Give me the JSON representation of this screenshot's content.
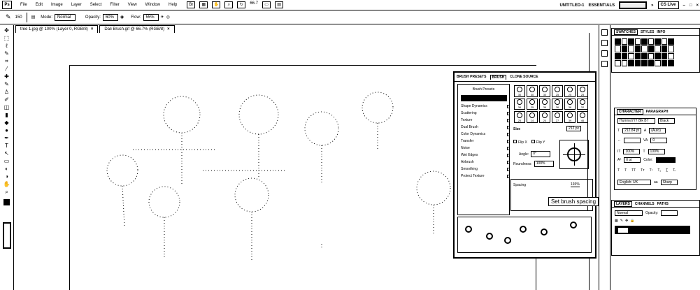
{
  "menubar": {
    "logo": "Ps",
    "items": [
      "File",
      "Edit",
      "Image",
      "Layer",
      "Select",
      "Filter",
      "View",
      "Window",
      "Help"
    ],
    "zoom": "66.7",
    "workspace": "UNTITLED-1",
    "essentials": "ESSENTIALS",
    "cs_live": "CS Live"
  },
  "options": {
    "brush_size": "150",
    "mode_label": "Mode:",
    "mode_value": "Normal",
    "opacity_label": "Opacity:",
    "opacity_value": "60%",
    "flow_label": "Flow:",
    "flow_value": "55%"
  },
  "tabs": [
    {
      "label": "tree 1.jpg @ 100% (Layer 0, RGB/8)"
    },
    {
      "label": "Dali Brush.gif @ 66.7% (RGB/8)"
    }
  ],
  "brush_panel": {
    "tabs": [
      "BRUSH PRESETS",
      "BRUSH",
      "CLONE SOURCE"
    ],
    "presets_button": "Brush Presets",
    "brush_tip_label": "Brush Tip Shape",
    "options": [
      "Shape Dynamics",
      "Scattering",
      "Texture",
      "Dual Brush",
      "Color Dynamics",
      "Transfer",
      "Noise",
      "Wet Edges",
      "Airbrush",
      "Smoothing",
      "Protect Texture"
    ],
    "tip_sizes": [
      "30",
      "30",
      "30",
      "25",
      "25",
      "25",
      "36",
      "25",
      "36",
      "36",
      "36",
      "32",
      "25",
      "14",
      "24",
      "27",
      "39",
      "46"
    ],
    "size_label": "Size",
    "size_value": "212 px",
    "flip_x": "Flip X",
    "flip_y": "Flip Y",
    "angle_label": "Angle:",
    "angle_value": "0°",
    "roundness_label": "Roundness:",
    "roundness_value": "100%",
    "spacing_label": "Spacing",
    "spacing_value": "193%",
    "tooltip": "Set brush spacing"
  },
  "right_panels": {
    "swatches_tabs": [
      "SWATCHES",
      "STYLES",
      "INFO"
    ],
    "character_tabs": [
      "CHARACTER",
      "PARAGRAPH"
    ],
    "font_family": "Humnst777 Blk BT",
    "font_style": "Black",
    "font_size": "212.84 pt",
    "leading": "(Auto)",
    "kerning": "0",
    "vertical_scale": "100%",
    "horizontal_scale": "100%",
    "baseline": "0 pt",
    "color_label": "Color:",
    "language": "English: UK",
    "antialias": "Sharp",
    "layers_tabs": [
      "LAYERS",
      "CHANNELS",
      "PATHS"
    ],
    "blend_mode": "Normal",
    "opacity_label": "Opacity:"
  }
}
